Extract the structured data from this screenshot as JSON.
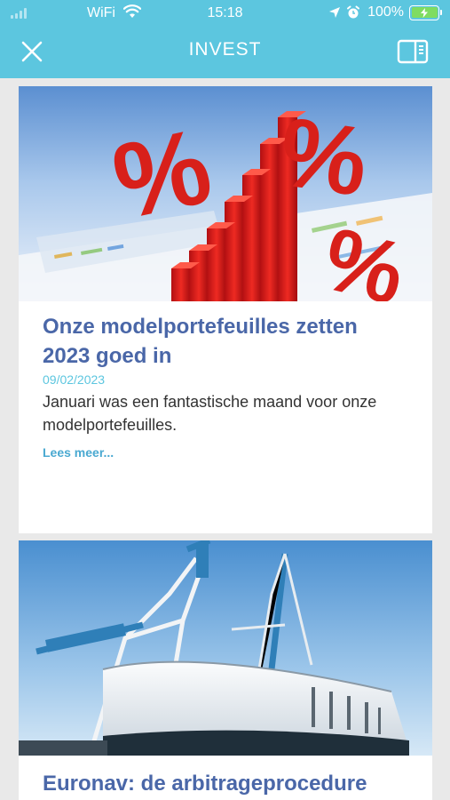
{
  "status_bar": {
    "carrier": "WiFi",
    "time": "15:18",
    "battery": "100%"
  },
  "header": {
    "title": "INVEST",
    "close_icon": "close-icon",
    "panel_icon": "sidebar-panel-icon"
  },
  "articles": [
    {
      "image": "red-percent-bar-chart-image",
      "title": "Onze modelportefeuilles zetten 2023 goed in",
      "date": "09/02/2023",
      "excerpt": "Januari was een fantastische maand voor onze modelportefeuilles.",
      "more": "Lees meer..."
    },
    {
      "image": "cargo-ship-crane-image",
      "title": "Euronav: de arbitrageprocedure"
    }
  ],
  "colors": {
    "header": "#5cc6df",
    "headline": "#4a67a8",
    "date": "#5cc6df",
    "link": "#4aa9d1"
  }
}
